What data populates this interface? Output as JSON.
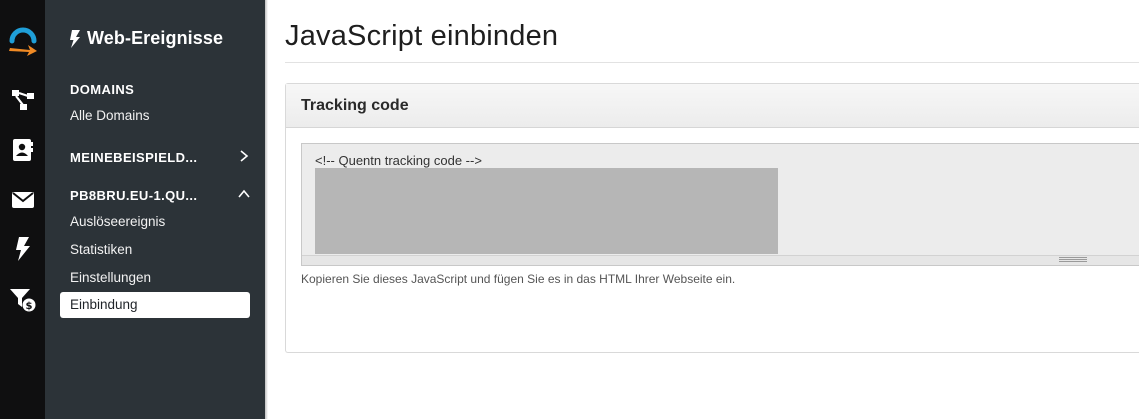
{
  "rail": {
    "icons": [
      "logo-icon",
      "hierarchy-icon",
      "contact-card-icon",
      "envelope-icon",
      "bolt-icon",
      "filter-dollar-icon"
    ],
    "accent_color": "#f08a24",
    "logo_color": "#1f9fd8"
  },
  "sidebar": {
    "title": "Web-Ereignisse",
    "domains_heading": "DOMAINS",
    "all_domains_link": "Alle Domains",
    "group1_label": "MEINEBEISPIELD...",
    "group2_label": "PB8BRU.EU-1.QU...",
    "items": [
      {
        "label": "Auslöseereignis"
      },
      {
        "label": "Statistiken"
      },
      {
        "label": "Einstellungen"
      },
      {
        "label": "Einbindung",
        "active": true
      }
    ]
  },
  "main": {
    "title": "JavaScript einbinden",
    "panel": {
      "heading": "Tracking code",
      "code_first_line": "<!-- Quentn tracking code -->",
      "help_text": "Kopieren Sie dieses JavaScript und fügen Sie es in das HTML Ihrer Webseite ein."
    }
  }
}
